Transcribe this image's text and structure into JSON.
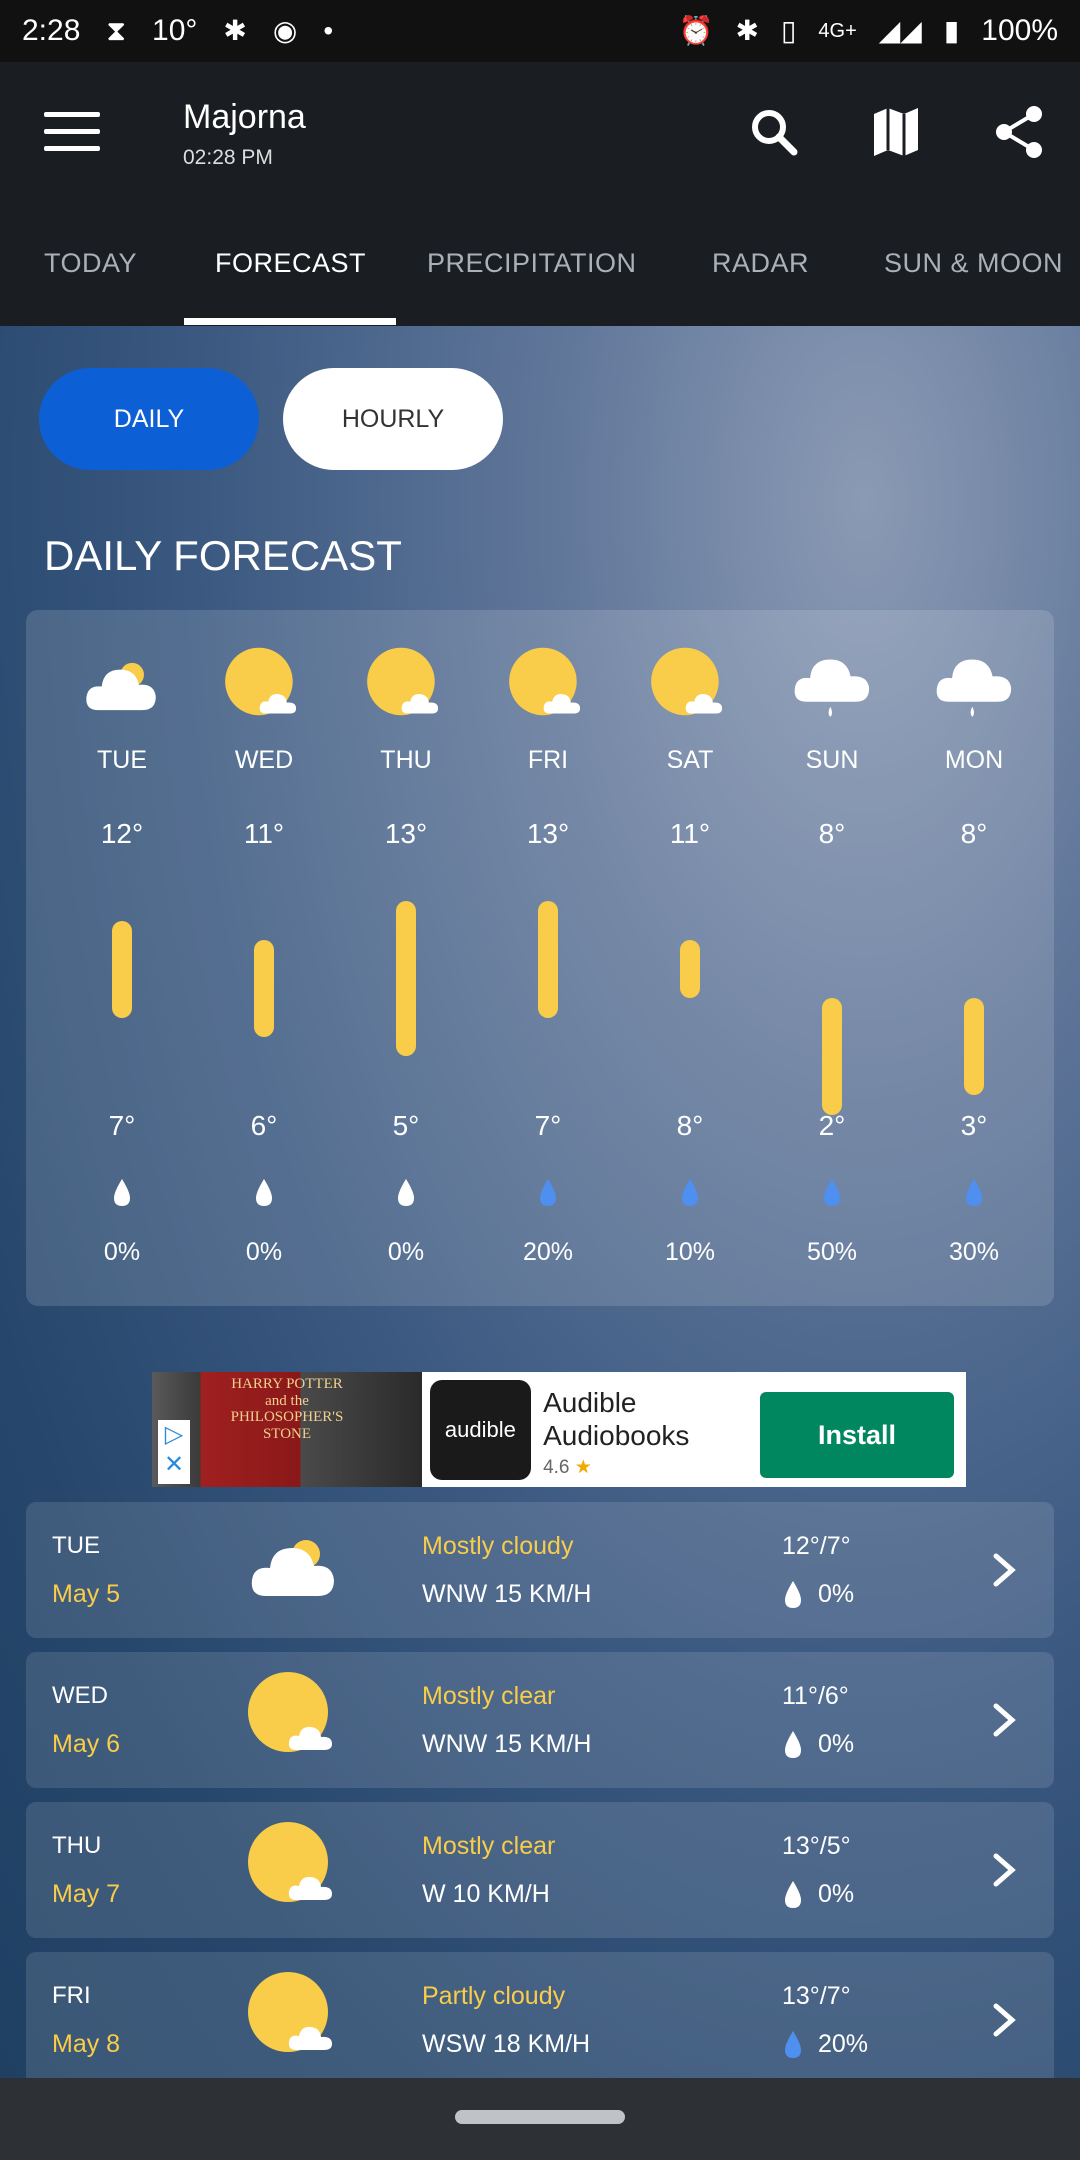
{
  "status": {
    "time": "2:28",
    "temp": "10°",
    "network": "4G+",
    "battery": "100%"
  },
  "header": {
    "location": "Majorna",
    "time": "02:28 PM"
  },
  "tabs": [
    "TODAY",
    "FORECAST",
    "PRECIPITATION",
    "RADAR",
    "SUN & MOON"
  ],
  "toggle": {
    "daily": "DAILY",
    "hourly": "HOURLY"
  },
  "section_title": "DAILY FORECAST",
  "days": [
    {
      "day": "TUE",
      "hi": "12°",
      "lo": "7°",
      "pct": "0%",
      "icon": "cloudy-icon",
      "drop": "white",
      "hi_val": 12,
      "lo_val": 7
    },
    {
      "day": "WED",
      "hi": "11°",
      "lo": "6°",
      "pct": "0%",
      "icon": "sun-cloud-icon",
      "drop": "white",
      "hi_val": 11,
      "lo_val": 6
    },
    {
      "day": "THU",
      "hi": "13°",
      "lo": "5°",
      "pct": "0%",
      "icon": "sun-cloud-icon",
      "drop": "white",
      "hi_val": 13,
      "lo_val": 5
    },
    {
      "day": "FRI",
      "hi": "13°",
      "lo": "7°",
      "pct": "20%",
      "icon": "sun-cloud-icon",
      "drop": "blue",
      "hi_val": 13,
      "lo_val": 7
    },
    {
      "day": "SAT",
      "hi": "11°",
      "lo": "8°",
      "pct": "10%",
      "icon": "sun-cloud-icon",
      "drop": "blue",
      "hi_val": 11,
      "lo_val": 8
    },
    {
      "day": "SUN",
      "hi": "8°",
      "lo": "2°",
      "pct": "50%",
      "icon": "rain-cloud-icon",
      "drop": "blue",
      "hi_val": 8,
      "lo_val": 2
    },
    {
      "day": "MON",
      "hi": "8°",
      "lo": "3°",
      "pct": "30%",
      "icon": "rain-cloud-icon",
      "drop": "blue",
      "hi_val": 8,
      "lo_val": 3
    }
  ],
  "ad": {
    "book_text": "HARRY POTTER and the PHILOSOPHER'S STONE",
    "logo": "audible",
    "name": "Audible Audiobooks",
    "rating": "4.6",
    "cta": "Install"
  },
  "rows": [
    {
      "day": "TUE",
      "date": "May 5",
      "cond": "Mostly cloudy",
      "wind": "WNW 15 KM/H",
      "temps": "12°/7°",
      "pct": "0%",
      "icon": "cloudy-icon",
      "drop": "white"
    },
    {
      "day": "WED",
      "date": "May 6",
      "cond": "Mostly clear",
      "wind": "WNW 15 KM/H",
      "temps": "11°/6°",
      "pct": "0%",
      "icon": "sun-cloud-icon",
      "drop": "white"
    },
    {
      "day": "THU",
      "date": "May 7",
      "cond": "Mostly clear",
      "wind": "W 10 KM/H",
      "temps": "13°/5°",
      "pct": "0%",
      "icon": "sun-cloud-icon",
      "drop": "white"
    },
    {
      "day": "FRI",
      "date": "May 8",
      "cond": "Partly cloudy",
      "wind": "WSW 18 KM/H",
      "temps": "13°/7°",
      "pct": "20%",
      "icon": "sun-cloud-icon",
      "drop": "blue"
    }
  ],
  "colors": {
    "accent": "#f9cd49",
    "blue_drop": "#4f8ff0",
    "pill_blue": "#0d5fd6"
  }
}
